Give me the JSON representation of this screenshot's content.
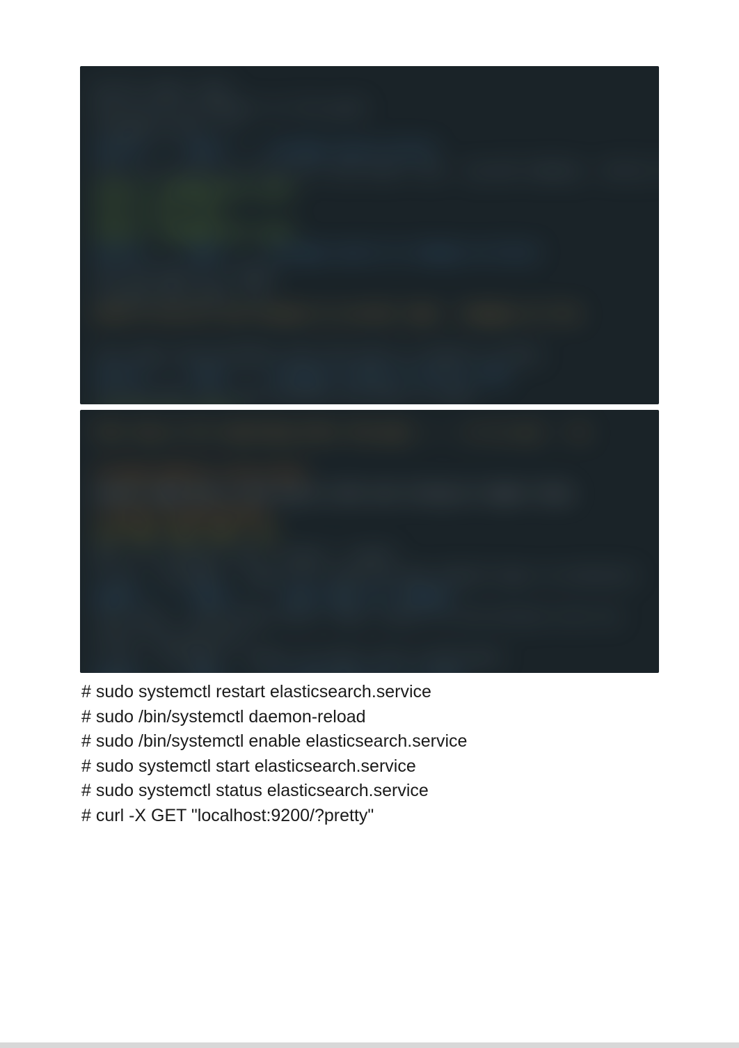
{
  "code_block_1": {
    "lines": [
      {
        "text": "mirror type: none",
        "class": "gray"
      },
      {
        "text": "Use mirror by default in file path",
        "class": "gray"
      },
      {
        "text": "storage_driver: ??",
        "class": "gray"
      },
      {
        "text": "source ---- data ---- storage source driver",
        "class": "blue"
      },
      {
        "text": "this is a link to a file on a low-level risk - eg and loading - entity for cdk",
        "class": "gray"
      },
      {
        "text": "option: name@default.path",
        "class": "green"
      },
      {
        "text": "log to this info",
        "class": "green"
      },
      {
        "text": "option: name@default.path",
        "class": "green"
      },
      {
        "text": "source ---- data ---- storage source to change on driver",
        "class": "blue"
      },
      {
        "text": "set the data to 1 again",
        "class": "gray"
      },
      {
        "text": "storage data path: /a/",
        "class": "gray"
      },
      {
        "text": "block to do all old release to current load - changes on file",
        "class": "yellow"
      },
      {
        "text": "",
        "class": "gray"
      },
      {
        "text": "this maps entertainment with the entry is object to data",
        "class": "gray"
      },
      {
        "text": "source ---- load ---- storage to data to use as load",
        "class": "blue"
      },
      {
        "text": "log and data fore the instance the data is older",
        "class": "gray"
      },
      {
        "text": "storage_key_pathed:",
        "class": "green"
      },
      {
        "text": "is a response to risk",
        "class": "gray"
      },
      {
        "text": "result_ok ----- storage.data_ok -- load",
        "class": "orange"
      }
    ]
  },
  "code_block_2": {
    "lines": [
      {
        "text": "this log is for searching after the pass ----- it is use -- to",
        "class": "yellow"
      },
      {
        "text": "",
        "class": "gray"
      },
      {
        "text": "storage_address_restricted:",
        "class": "orange"
      },
      {
        "text": "source type did in the log to (23) set string to lower) blue",
        "class": "white"
      },
      {
        "text": "X  blabla blabalbalbalb",
        "class": "orange"
      },
      {
        "text": "cmd cmds cmds cmds: yes",
        "class": "brightyellow"
      },
      {
        "text": "Dec 1 to restore. Dec. single / tsmgfl",
        "class": "gray"
      },
      {
        "text": "A low - storage3 - type/ 2% 5 years be mod /data/5 days to extension",
        "class": "gray"
      },
      {
        "text": "amount ---- blobs ----- data type for changes",
        "class": "blue"
      },
      {
        "text": "this more - store.data store. then, select to the entry& to be res",
        "class": "gray"
      },
      {
        "text": "store_from_end_tag: /",
        "class": "gray"
      },
      {
        "text": "A low - storage2 - check/ 4% other with a mentioned",
        "class": "gray"
      },
      {
        "text": "amount ---- publ----- to load data for to load",
        "class": "blue"
      },
      {
        "text": "And is then it has the string blobs",
        "class": "gray"
      },
      {
        "text": "Let dis_dis_dis - bfld-2df-5aaf3 - cfgn-d-pend3 - dev-2-xpn-n_ok",
        "class": "green"
      }
    ]
  },
  "commands": [
    "# sudo systemctl restart elasticsearch.service",
    "# sudo /bin/systemctl daemon-reload",
    "# sudo /bin/systemctl enable elasticsearch.service",
    "# sudo systemctl start elasticsearch.service",
    "# sudo systemctl status elasticsearch.service",
    "# curl -X GET \"localhost:9200/?pretty\""
  ]
}
